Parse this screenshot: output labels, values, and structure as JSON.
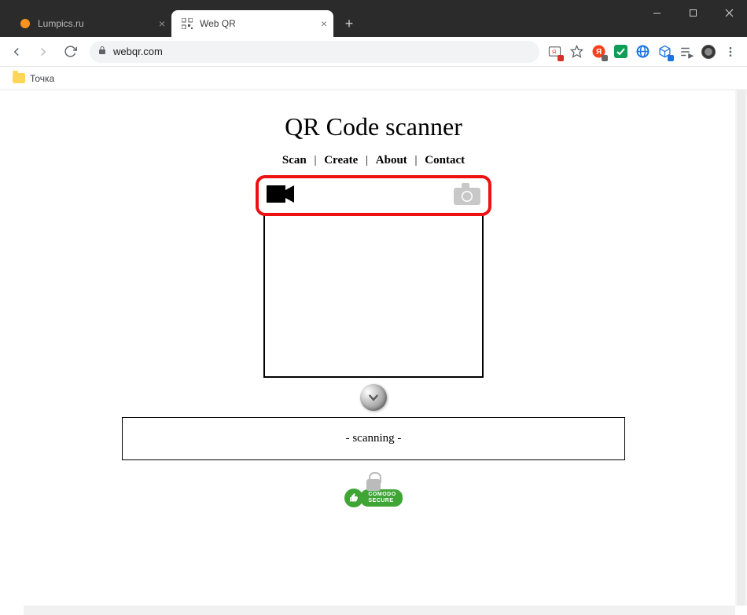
{
  "browser": {
    "tabs": [
      {
        "title": "Lumpics.ru",
        "active": false,
        "favicon": "orange-circle"
      },
      {
        "title": "Web QR",
        "active": true,
        "favicon": "qr"
      }
    ],
    "url": "webqr.com",
    "bookmarks": [
      {
        "label": "Точка"
      }
    ]
  },
  "page": {
    "title": "QR Code scanner",
    "menu": [
      "Scan",
      "Create",
      "About",
      "Contact"
    ],
    "status": "- scanning -",
    "secure_badge": {
      "line1": "COMODO",
      "line2": "SECURE"
    }
  }
}
